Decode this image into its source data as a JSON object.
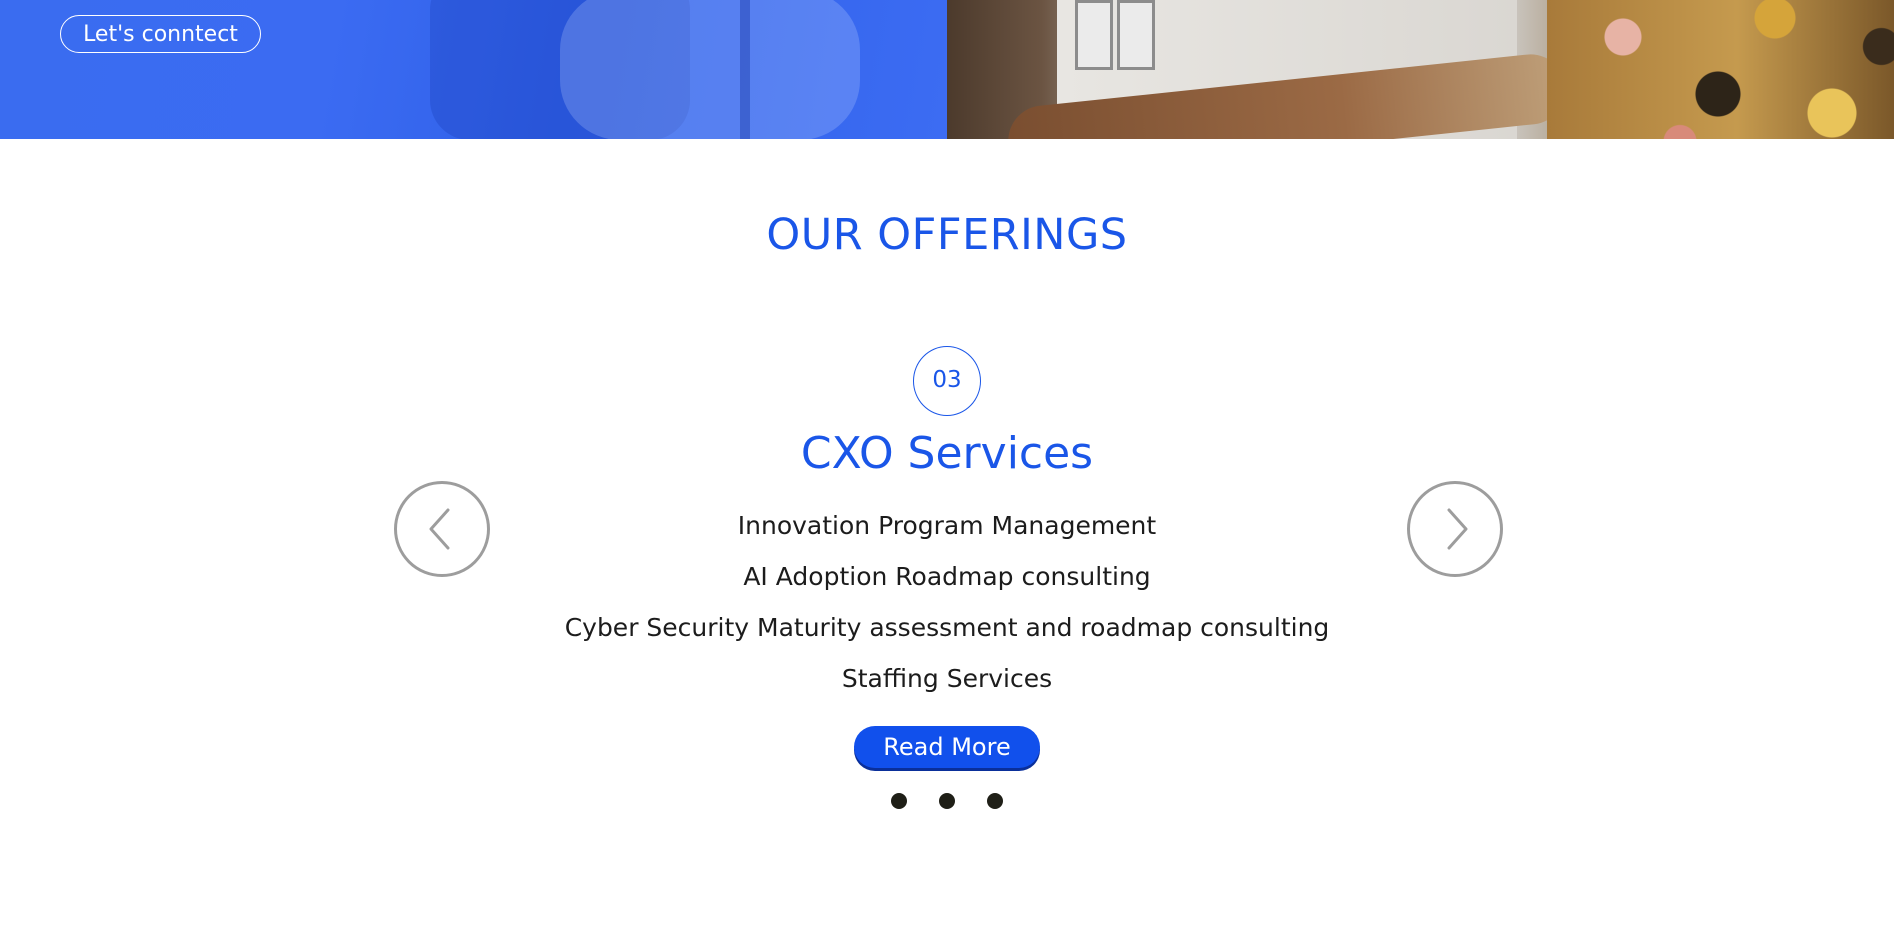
{
  "hero": {
    "connect_label": "Let's conntect"
  },
  "offerings": {
    "section_title": "OUR OFFERINGS",
    "slide_number": "03",
    "slide_title": "CXO Services",
    "items": [
      "Innovation Program Management",
      "AI Adoption Roadmap consulting",
      "Cyber Security Maturity assessment and roadmap consulting",
      "Staffing Services"
    ],
    "read_more_label": "Read More",
    "pagination_dots": 3
  },
  "colors": {
    "brand_blue": "#1a56e8",
    "hero_blue": "#3a6cf0",
    "dot": "#1f1f17",
    "arrow_border": "#9d9d9d"
  },
  "icons": {
    "prev": "chevron-left-icon",
    "next": "chevron-right-icon"
  }
}
